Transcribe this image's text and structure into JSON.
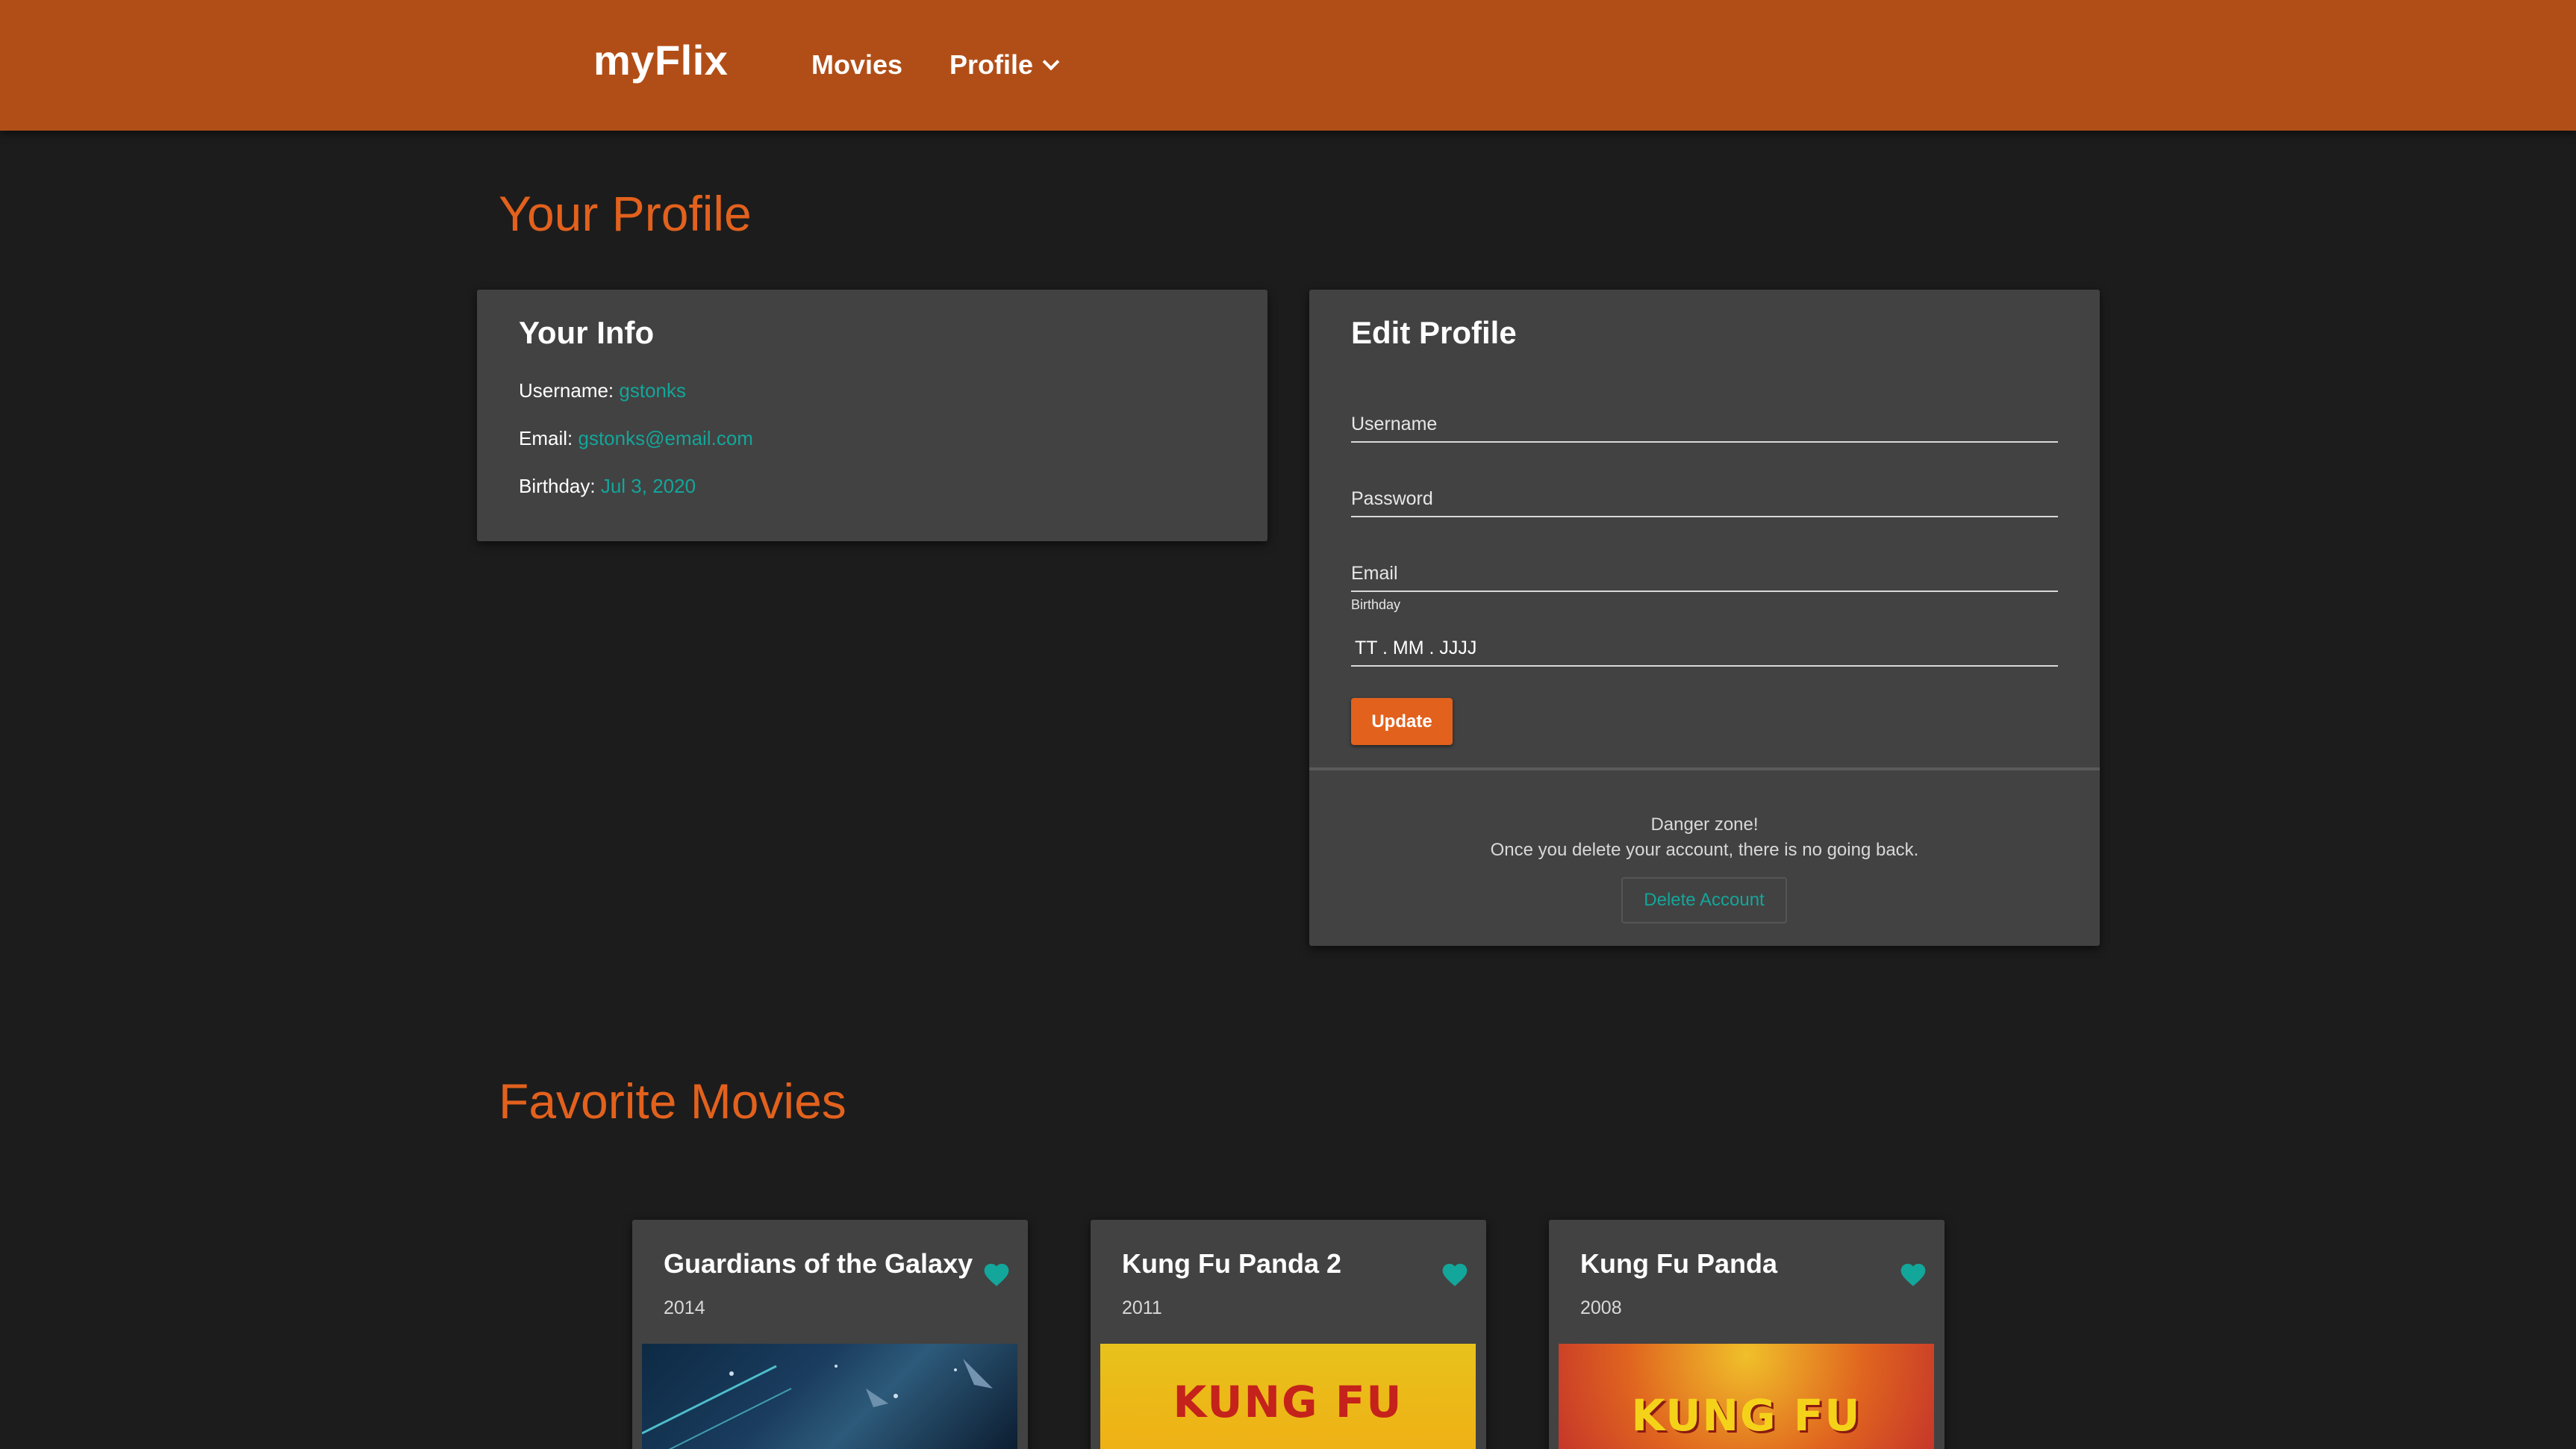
{
  "nav": {
    "brand": "myFlix",
    "movies": "Movies",
    "profile": "Profile"
  },
  "profile_title": "Your Profile",
  "info": {
    "title": "Your Info",
    "username_label": "Username:",
    "username_value": "gstonks",
    "email_label": "Email:",
    "email_value": "gstonks@email.com",
    "birthday_label": "Birthday:",
    "birthday_value": "Jul 3, 2020"
  },
  "edit": {
    "title": "Edit Profile",
    "username_label": "Username",
    "password_label": "Password",
    "email_label": "Email",
    "birthday_label": "Birthday",
    "birthday_placeholder": "TT . MM . JJJJ",
    "update_label": "Update",
    "danger_line1": "Danger zone!",
    "danger_line2": "Once you delete your account, there is no going back.",
    "delete_label": "Delete Account"
  },
  "favorites_title": "Favorite Movies",
  "movies": [
    {
      "title": "Guardians of the Galaxy",
      "year": "2014",
      "icon": "heart-icon",
      "poster_text": ""
    },
    {
      "title": "Kung Fu Panda 2",
      "year": "2011",
      "icon": "heart-icon",
      "poster_text": "KUNG FU"
    },
    {
      "title": "Kung Fu Panda",
      "year": "2008",
      "icon": "heart-icon",
      "poster_text": "KUNG FU"
    }
  ],
  "colors": {
    "navbar": "#b14e17",
    "accent": "#e2611d",
    "teal": "#13a69a",
    "card": "#424242",
    "background": "#1c1c1c"
  }
}
